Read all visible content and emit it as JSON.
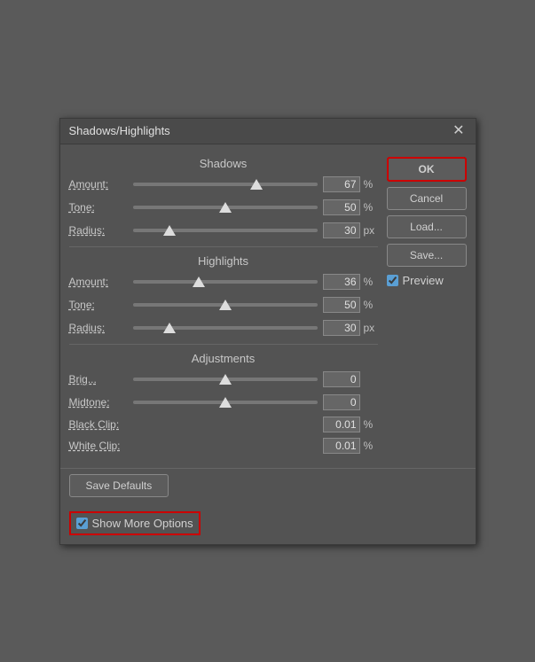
{
  "dialog": {
    "title": "Shadows/Highlights",
    "close_label": "✕"
  },
  "sections": {
    "shadows": {
      "header": "Shadows",
      "amount_label": "Amount:",
      "amount_value": "67",
      "amount_unit": "%",
      "amount_thumb_pct": 67,
      "tone_label": "Tone:",
      "tone_value": "50",
      "tone_unit": "%",
      "tone_thumb_pct": 50,
      "radius_label": "Radius:",
      "radius_value": "30",
      "radius_unit": "px",
      "radius_thumb_pct": 20
    },
    "highlights": {
      "header": "Highlights",
      "amount_label": "Amount:",
      "amount_value": "36",
      "amount_unit": "%",
      "amount_thumb_pct": 36,
      "tone_label": "Tone:",
      "tone_value": "50",
      "tone_unit": "%",
      "tone_thumb_pct": 50,
      "radius_label": "Radius:",
      "radius_value": "30",
      "radius_unit": "px",
      "radius_thumb_pct": 20
    },
    "adjustments": {
      "header": "Adjustments",
      "brig_label": "Brig...",
      "brig_value": "0",
      "brig_thumb_pct": 50,
      "midtone_label": "Midtone:",
      "midtone_value": "0",
      "midtone_thumb_pct": 50,
      "black_clip_label": "Black Clip:",
      "black_clip_value": "0.01",
      "black_clip_unit": "%",
      "white_clip_label": "White Clip:",
      "white_clip_value": "0.01",
      "white_clip_unit": "%"
    }
  },
  "buttons": {
    "ok_label": "OK",
    "cancel_label": "Cancel",
    "load_label": "Load...",
    "save_label": "Save...",
    "preview_label": "Preview",
    "save_defaults_label": "Save Defaults",
    "show_more_label": "Show More Options"
  }
}
